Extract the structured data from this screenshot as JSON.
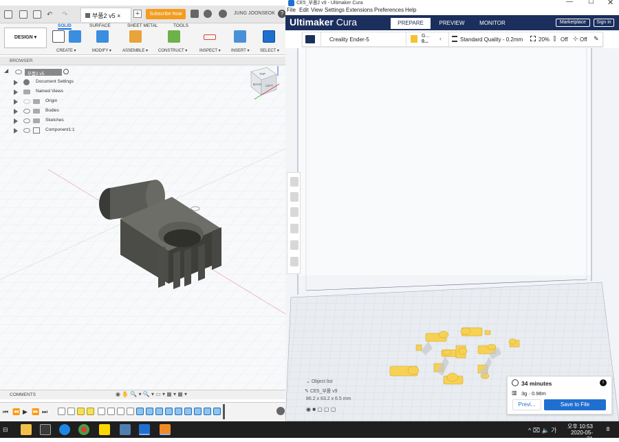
{
  "fusion": {
    "doc_tab": "부품2 v5",
    "subscribe_label": "Subscribe Now",
    "user": "JUNG JOONSEOK",
    "design_label": "DESIGN ▾",
    "ribbon_tabs": [
      "SOLID",
      "SURFACE",
      "SHEET METAL",
      "TOOLS"
    ],
    "active_tab": "SOLID",
    "groups": [
      "CREATE ▾",
      "MODIFY ▾",
      "ASSEMBLE ▾",
      "CONSTRUCT ▾",
      "INSPECT ▾",
      "INSERT ▾",
      "SELECT ▾"
    ],
    "browser_label": "BROWSER",
    "tree": {
      "root": "부품2 v5",
      "items": [
        "Document Settings",
        "Named Views",
        "Origin",
        "Bodies",
        "Sketches",
        "Component1:1"
      ]
    },
    "comments_label": "COMMENTS",
    "viewcube_labels": [
      "TOP",
      "BACK",
      "LEFT",
      "X",
      "Y",
      "Z"
    ]
  },
  "cura": {
    "title": "CE5_부품2 v9 - Ultimaker Cura",
    "menu": [
      "File",
      "Edit",
      "View",
      "Settings",
      "Extensions",
      "Preferences",
      "Help"
    ],
    "brand_bold": "Ultimaker",
    "brand_light": " Cura",
    "stages": [
      "PREPARE",
      "PREVIEW",
      "MONITOR"
    ],
    "active_stage": "PREPARE",
    "marketplace_label": "Marketplace",
    "signin_label": "Sign in",
    "printer": "Creality Ender-5",
    "material_short": "G...",
    "material_sub": "0...",
    "quality": "Standard Quality - 0.2mm",
    "infill": "20%",
    "support": "Off",
    "adhesion": "Off",
    "object_list_label": "Object list",
    "object_name": "CE5_부품 v9",
    "object_dims": "86.2 x 63.2 x 6.5 mm",
    "print_time": "34 minutes",
    "material_usage": "3g · 0.98m",
    "preview_label": "Previ...",
    "save_label": "Save to File"
  },
  "taskbar": {
    "time": "오후 10:53",
    "date": "2020-05-31",
    "notifications": "8"
  },
  "colors": {
    "cura_header": "#1b2f5d",
    "cura_blue": "#1f6fd1",
    "fusion_orange": "#f39c1e",
    "model_yellow": "#f6d154"
  }
}
